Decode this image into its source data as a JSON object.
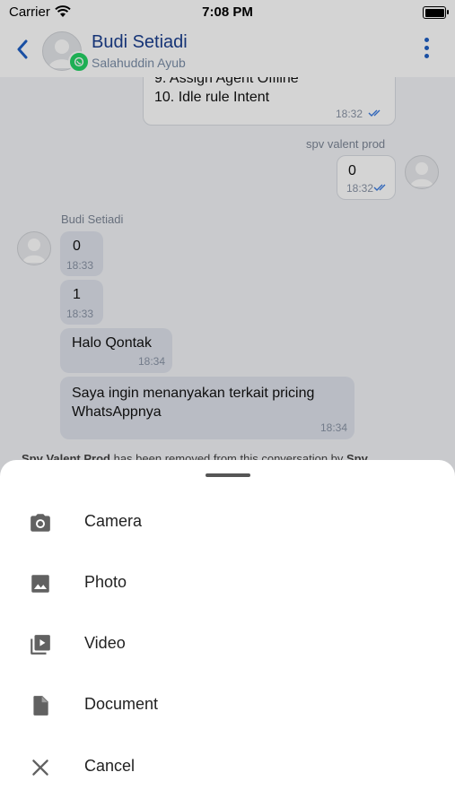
{
  "status_bar": {
    "carrier": "Carrier",
    "time": "7:08 PM"
  },
  "header": {
    "name": "Budi Setiadi",
    "subtitle": "Salahuddin Ayub",
    "channel_icon": "whatsapp-icon",
    "accent": "#1b3f8f"
  },
  "messages": {
    "m1": {
      "line1": "9. Assign Agent Offline",
      "line2": "10. Idle rule Intent",
      "time": "18:32"
    },
    "spv_sender": "spv valent prod",
    "m2": {
      "text": "0",
      "time": "18:32"
    },
    "contact_sender": "Budi Setiadi",
    "m3": {
      "text": "0",
      "time": "18:33"
    },
    "m4": {
      "text": "1",
      "time": "18:33"
    },
    "m5": {
      "text": "Halo Qontak",
      "time": "18:34"
    },
    "m6": {
      "line1": "Saya ingin menanyakan terkait pricing",
      "line2": "WhatsAppnya",
      "time": "18:34"
    },
    "system": {
      "bold1": "Spv Valent Prod",
      "text": " has been removed from this conversation by ",
      "bold2": "Spv"
    }
  },
  "sheet": {
    "options": [
      {
        "label": "Camera",
        "icon": "camera-icon"
      },
      {
        "label": "Photo",
        "icon": "photo-icon"
      },
      {
        "label": "Video",
        "icon": "video-library-icon"
      },
      {
        "label": "Document",
        "icon": "document-icon"
      },
      {
        "label": "Cancel",
        "icon": "close-icon"
      }
    ]
  }
}
